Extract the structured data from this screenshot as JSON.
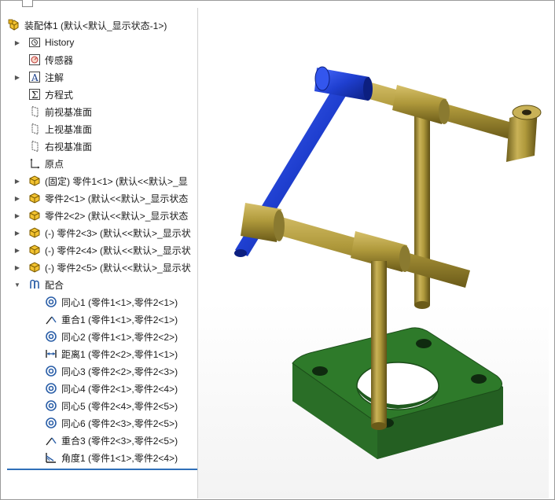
{
  "tree": {
    "root_label": "装配体1  (默认<默认_显示状态-1>)",
    "items": [
      {
        "label": "History",
        "icon": "history-icon",
        "expand": true
      },
      {
        "label": "传感器",
        "icon": "sensor-icon",
        "expand": false
      },
      {
        "label": "注解",
        "icon": "annotation-icon",
        "expand": true
      },
      {
        "label": "方程式",
        "icon": "equation-icon",
        "expand": false
      },
      {
        "label": "前视基准面",
        "icon": "plane-icon",
        "expand": false
      },
      {
        "label": "上视基准面",
        "icon": "plane-icon",
        "expand": false
      },
      {
        "label": "右视基准面",
        "icon": "plane-icon",
        "expand": false
      },
      {
        "label": "原点",
        "icon": "origin-icon",
        "expand": false
      },
      {
        "label": "(固定) 零件1<1> (默认<<默认>_显",
        "icon": "part-icon",
        "expand": true
      },
      {
        "label": "零件2<1> (默认<<默认>_显示状态",
        "icon": "part-icon",
        "expand": true
      },
      {
        "label": "零件2<2> (默认<<默认>_显示状态",
        "icon": "part-icon",
        "expand": true
      },
      {
        "label": "(-) 零件2<3> (默认<<默认>_显示状",
        "icon": "part-icon",
        "expand": true
      },
      {
        "label": "(-) 零件2<4> (默认<<默认>_显示状",
        "icon": "part-icon",
        "expand": true
      },
      {
        "label": "(-) 零件2<5> (默认<<默认>_显示状",
        "icon": "part-icon",
        "expand": true
      }
    ],
    "mates_label": "配合",
    "mates": [
      {
        "label": "同心1 (零件1<1>,零件2<1>)",
        "icon": "concentric-icon"
      },
      {
        "label": "重合1 (零件1<1>,零件2<1>)",
        "icon": "coincident-icon"
      },
      {
        "label": "同心2 (零件1<1>,零件2<2>)",
        "icon": "concentric-icon"
      },
      {
        "label": "距离1 (零件2<2>,零件1<1>)",
        "icon": "distance-icon"
      },
      {
        "label": "同心3 (零件2<2>,零件2<3>)",
        "icon": "concentric-icon"
      },
      {
        "label": "同心4 (零件2<1>,零件2<4>)",
        "icon": "concentric-icon"
      },
      {
        "label": "同心5 (零件2<4>,零件2<5>)",
        "icon": "concentric-icon"
      },
      {
        "label": "同心6 (零件2<3>,零件2<5>)",
        "icon": "concentric-icon"
      },
      {
        "label": "重合3 (零件2<3>,零件2<5>)",
        "icon": "coincident-icon"
      },
      {
        "label": "角度1 (零件1<1>,零件2<4>)",
        "icon": "angle-icon"
      }
    ]
  },
  "colors": {
    "blue_part": "#1f3fd0",
    "gold_part": "#b09a3c",
    "green_base": "#2e7a2a",
    "selection_line": "#2f6fb8"
  }
}
